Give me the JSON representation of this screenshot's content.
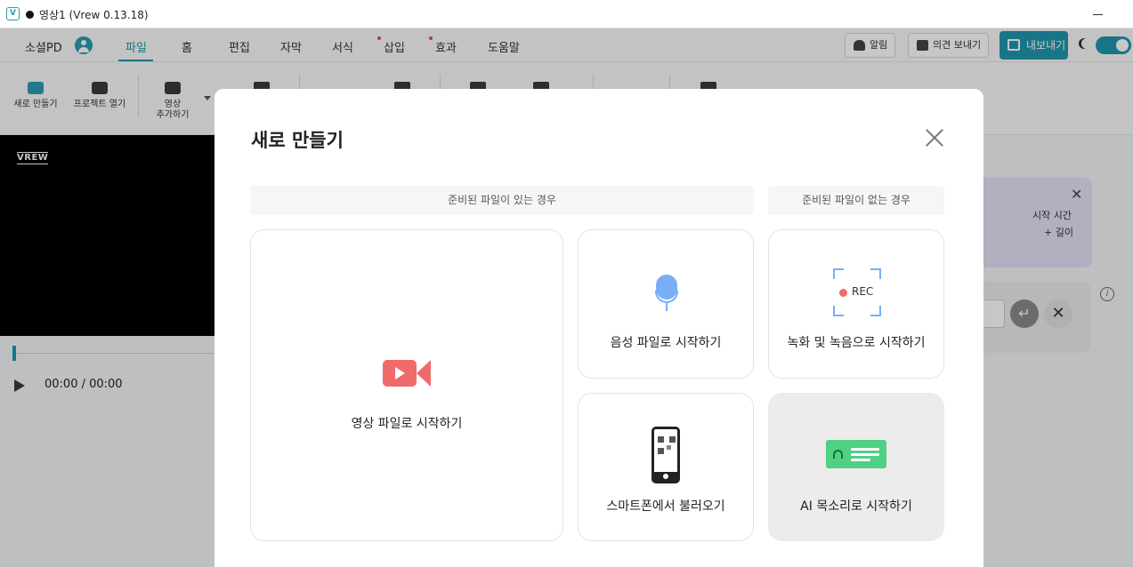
{
  "window": {
    "title": "영상1 (Vrew 0.13.18)"
  },
  "menubar": {
    "user": "소셜PD",
    "tabs": [
      "파일",
      "홈",
      "편집",
      "자막",
      "서식",
      "삽입",
      "효과",
      "도움말"
    ],
    "active_tab": "파일",
    "alert_button": "알림",
    "feedback_button": "의견 보내기",
    "export_button": "내보내기"
  },
  "toolbar": {
    "new": "새로 만들기",
    "open_project": "프로젝트 열기",
    "add_video_line1": "영상",
    "add_video_line2": "추가하기"
  },
  "preview": {
    "logo": "VREW",
    "timecode": "00:00 / 00:00"
  },
  "side_panel": {
    "start_time": "시작 시간",
    "length": "+ 길이"
  },
  "modal": {
    "title": "새로 만들기",
    "section_with_file": "준비된 파일이 있는 경우",
    "section_without_file": "준비된 파일이 없는 경우",
    "cards": {
      "video": "영상 파일로 시작하기",
      "audio": "음성 파일로 시작하기",
      "record": "녹화 및 녹음으로 시작하기",
      "record_badge": "REC",
      "phone": "스마트폰에서 불러오기",
      "ai_voice": "AI 목소리로 시작하기"
    }
  },
  "colors": {
    "accent": "#1f97ad",
    "video_icon": "#ef6b6b",
    "mic_icon": "#78aef5",
    "ai_icon": "#4fd083",
    "notification_dot": "#e24b4b"
  }
}
